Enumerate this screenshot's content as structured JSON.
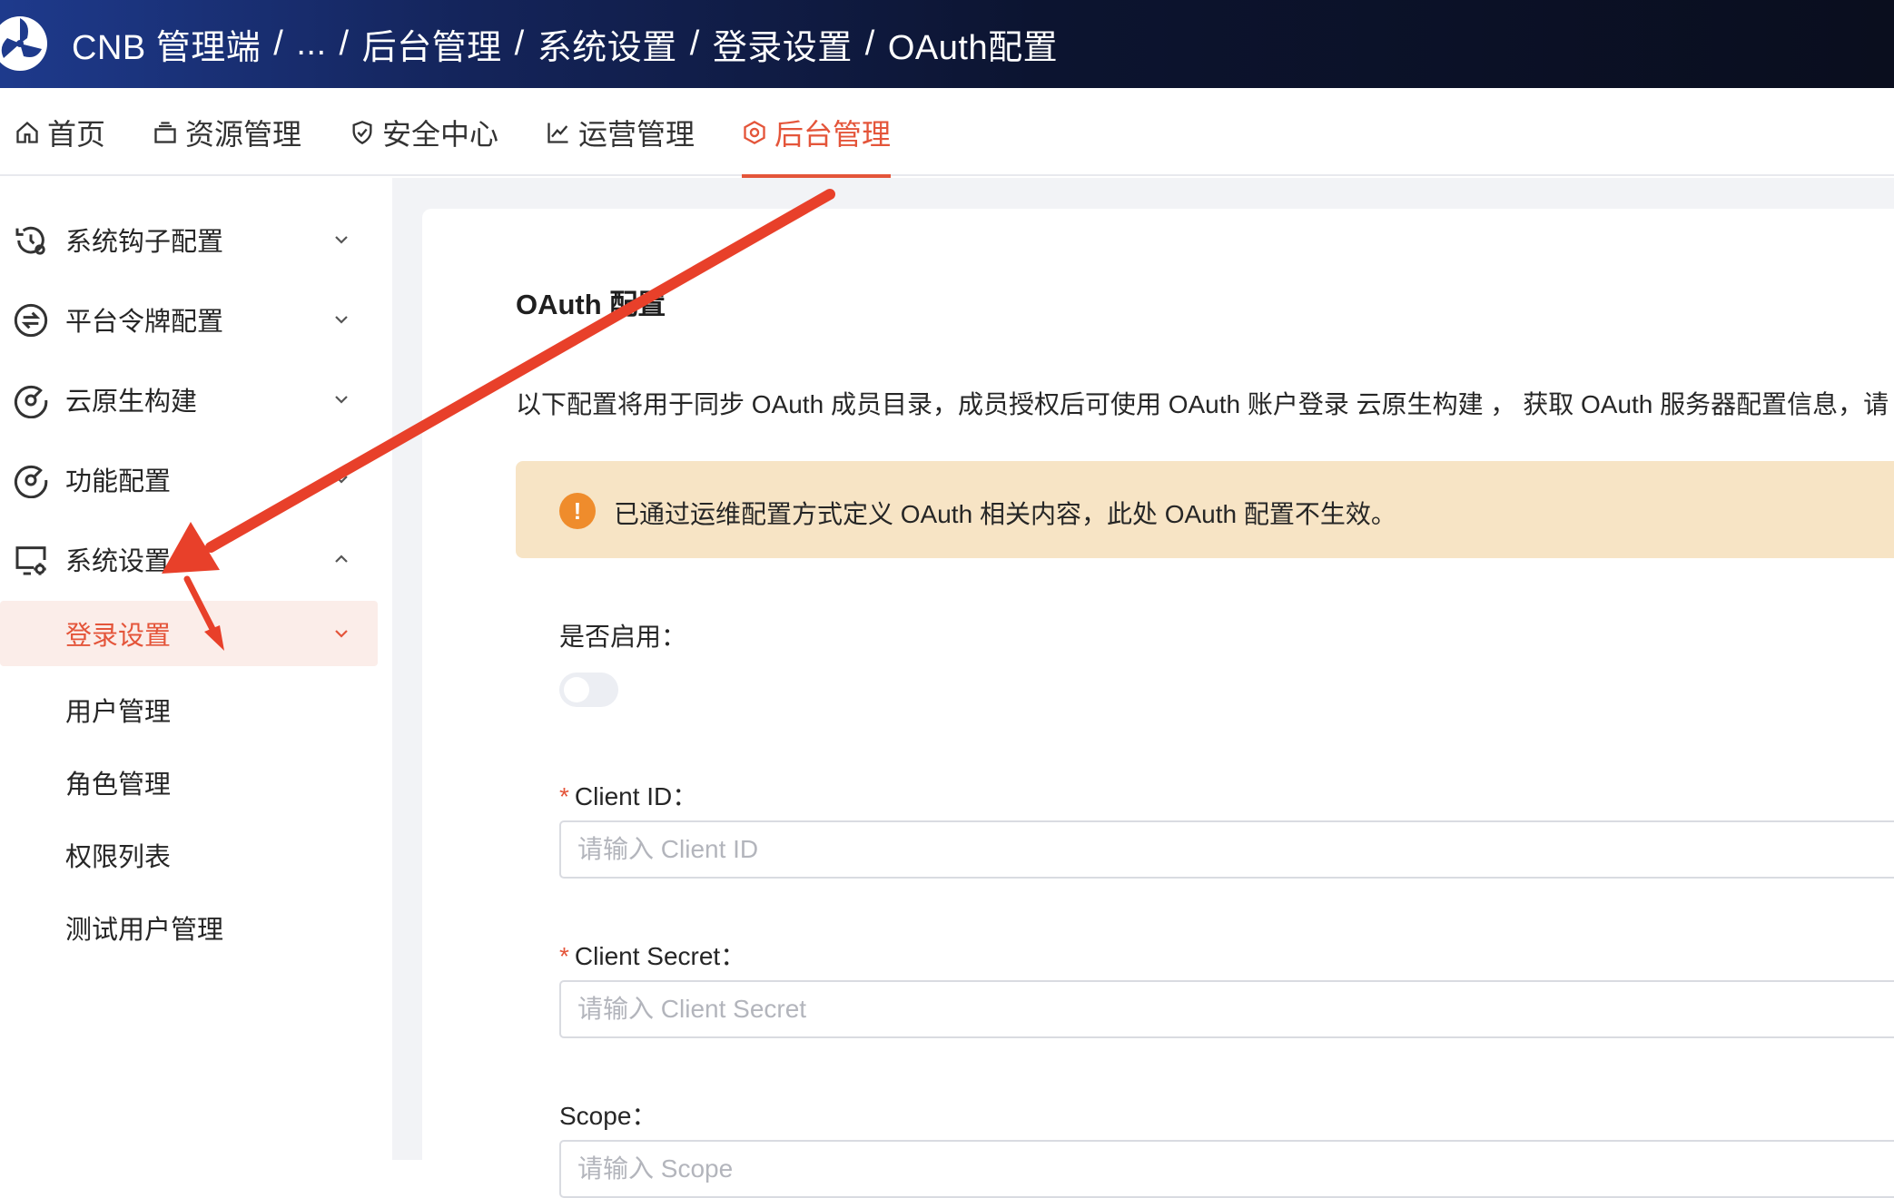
{
  "header": {
    "breadcrumb": [
      "CNB 管理端",
      "...",
      "后台管理",
      "系统设置",
      "登录设置",
      "OAuth配置"
    ],
    "separator": "/",
    "background_color": "#0c1430"
  },
  "topnav": {
    "items": [
      {
        "label": "首页",
        "icon": "home-icon"
      },
      {
        "label": "资源管理",
        "icon": "resource-icon"
      },
      {
        "label": "安全中心",
        "icon": "shield-icon"
      },
      {
        "label": "运营管理",
        "icon": "line-chart-icon"
      },
      {
        "label": "后台管理",
        "icon": "gear-hex-icon",
        "active": true
      }
    ],
    "accent_color": "#e4553a"
  },
  "sidebar": {
    "items": [
      {
        "label": "系统钩子配置",
        "icon": "hook-history-icon",
        "expanded": false
      },
      {
        "label": "平台令牌配置",
        "icon": "token-exchange-icon",
        "expanded": false
      },
      {
        "label": "云原生构建",
        "icon": "build-gauge-icon",
        "expanded": false
      },
      {
        "label": "功能配置",
        "icon": "feature-gauge-icon",
        "expanded": false
      },
      {
        "label": "系统设置",
        "icon": "monitor-gear-icon",
        "expanded": true
      }
    ],
    "sub_items": [
      {
        "label": "登录设置",
        "active": true
      },
      {
        "label": "用户管理"
      },
      {
        "label": "角色管理"
      },
      {
        "label": "权限列表"
      },
      {
        "label": "测试用户管理"
      }
    ]
  },
  "main": {
    "title": "OAuth 配置",
    "description": "以下配置将用于同步 OAuth 成员目录，成员授权后可使用 OAuth 账户登录 云原生构建 ， 获取 OAuth 服务器配置信息，请",
    "alert": {
      "icon": "warning-icon",
      "text": "已通过运维配置方式定义 OAuth 相关内容，此处 OAuth 配置不生效。"
    },
    "form": {
      "enable_label": "是否启用：",
      "enabled": false,
      "client_id_label": "Client ID：",
      "client_id_placeholder": "请输入 Client ID",
      "client_id_value": "",
      "client_secret_label": "Client Secret：",
      "client_secret_placeholder": "请输入 Client Secret",
      "client_secret_value": "",
      "scope_label": "Scope：",
      "scope_placeholder": "请输入 Scope",
      "required_mark": "*"
    }
  },
  "annotation": {
    "arrow_color": "#e8402a"
  }
}
